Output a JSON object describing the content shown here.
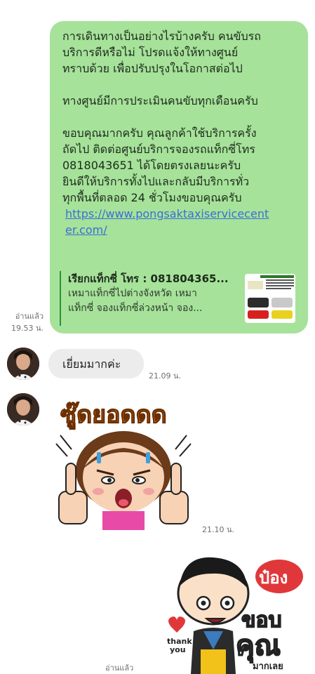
{
  "outgoing_message": {
    "paragraph1": [
      "การเดินทางเป็นอย่างไรบ้างครับ คนขับรถ",
      "บริการดีหรือไม่ โปรดแจ้งให้ทางศูนย์",
      "ทราบด้วย เพื่อปรับปรุงในโอกาสต่อไป"
    ],
    "paragraph2": "ทางศูนย์มีการประเมินคนขับทุกเดือนครับ",
    "paragraph3": [
      "ขอบคุณมากครับ คุณลูกค้าใช้บริการครั้ง",
      "ถัดไป ติดต่อศูนย์บริการจองรถแท็กซี่โทร",
      "0818043651 ได้โดยตรงเลยนะครับ",
      "ยินดีให้บริการทั้งไปและกลับมีบริการทั่ว",
      "ทุกพื้นที่ตลอด 24 ชั่วโมงขอบคุณครับ"
    ],
    "link": [
      "https://www.pongsaktaxiservicecent",
      "er.com/"
    ],
    "preview_title": "เรียกแท็กซี่ โทร : 081804365...",
    "preview_desc": [
      "เหมาแท็กซี่ไปต่างจังหวัด เหมา",
      "แท็กซี่ จองแท็กซี่ล่วงหน้า จอง..."
    ],
    "read": "อ่านแล้ว",
    "time": "19.53 น."
  },
  "incoming_message": {
    "text": "เยี่ยมมากค่ะ",
    "time": "21.09 น."
  },
  "incoming_sticker": {
    "caption": "ซู๊ดยอดดด",
    "time": "21.10 น."
  },
  "outgoing_sticker": {
    "text_top": "ป๋อง",
    "text_mid": "ขอบ",
    "text_big": "คุณ",
    "text_small": "มากเลย",
    "text_thank": "thank",
    "text_you": "you",
    "read": "อ่านแล้ว"
  },
  "colors": {
    "outgoing_bubble": "#a6e29a",
    "incoming_bubble": "#ececec",
    "link": "#3b6fd6"
  }
}
